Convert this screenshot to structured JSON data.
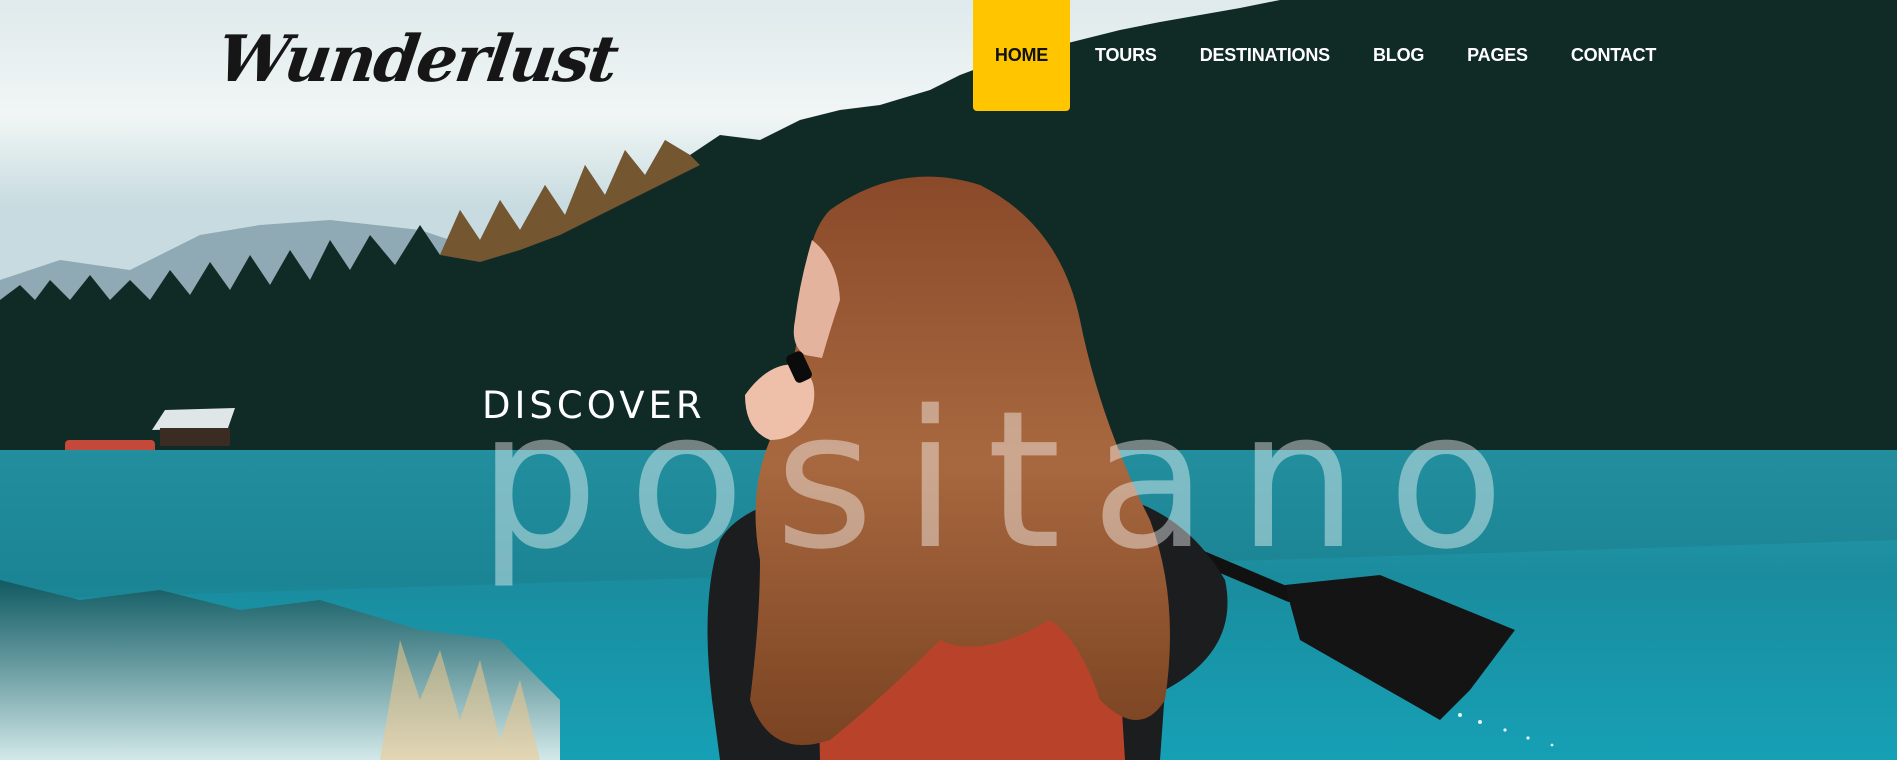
{
  "brand": {
    "logo_text": "Wunderlust"
  },
  "nav": {
    "items": [
      {
        "label": "HOME",
        "active": true
      },
      {
        "label": "TOURS",
        "active": false
      },
      {
        "label": "DESTINATIONS",
        "active": false
      },
      {
        "label": "BLOG",
        "active": false
      },
      {
        "label": "PAGES",
        "active": false
      },
      {
        "label": "CONTACT",
        "active": false
      }
    ]
  },
  "hero": {
    "eyebrow": "DISCOVER",
    "headline": "positano"
  },
  "colors": {
    "accent": "#ffc600",
    "nav_text": "#ffffff",
    "lake": "#1b8fa0"
  }
}
